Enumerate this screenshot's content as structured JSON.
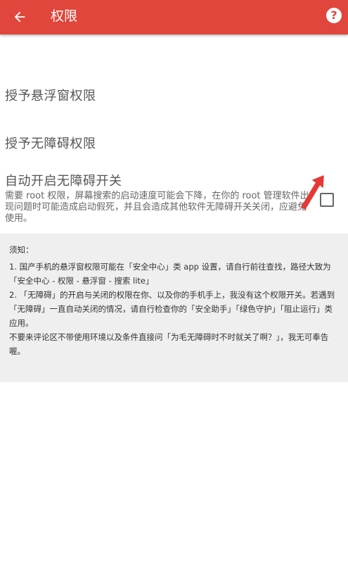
{
  "appbar": {
    "title": "权限",
    "back_icon": "arrow-left-icon",
    "help_icon": "help-circle-icon",
    "help_glyph": "?",
    "color": "#e0463c"
  },
  "preferences": [
    {
      "title": "授予悬浮窗权限"
    },
    {
      "title": "授予无障碍权限"
    },
    {
      "title": "自动开启无障碍开关",
      "summary": "需要 root 权限，屏幕搜索的启动速度可能会下降，在你的 root 管理软件出现问题时可能造成启动假死，并且会造成其他软件无障碍开关关闭，应避免使用。",
      "checked": false
    }
  ],
  "notice": {
    "title": "须知：",
    "lines": [
      "1. 国产手机的悬浮窗权限可能在「安全中心」类 app 设置，请自行前往查找，路径大致为「安全中心 - 权限 - 悬浮窗 - 搜索 lite」",
      "2. 「无障碍」的开启与关闭的权限在你、以及你的手机手上，我没有这个权限开关。若遇到「无障碍」一直自动关闭的情况，请自行检查你的「安全助手」「绿色守护」「阻止运行」类应用。",
      "不要来评论区不带使用环境以及条件直接问「为毛无障碍时不时就关了啊？」，我无可奉告喔。"
    ]
  },
  "annotation": {
    "icon": "red-arrow-icon",
    "color": "#e53935"
  }
}
